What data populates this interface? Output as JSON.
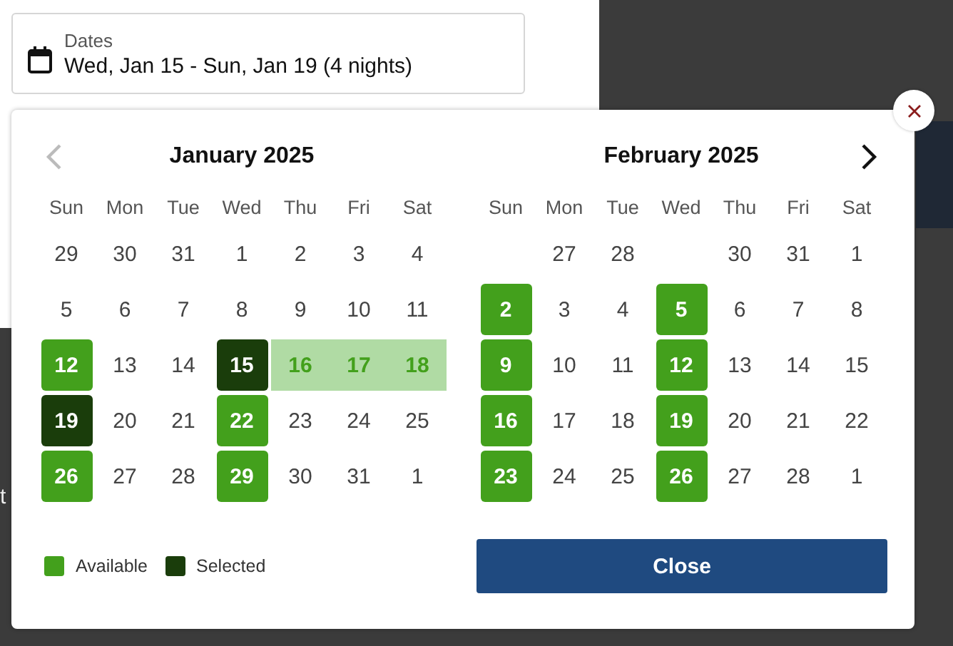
{
  "date_field": {
    "label": "Dates",
    "value": "Wed, Jan 15 - Sun, Jan 19 (4 nights)"
  },
  "background_text": "t",
  "calendar": {
    "prev_disabled": true,
    "next_disabled": false,
    "months": [
      {
        "title": "January 2025",
        "weekdays": [
          "Sun",
          "Mon",
          "Tue",
          "Wed",
          "Thu",
          "Fri",
          "Sat"
        ],
        "days": [
          {
            "day": "29",
            "kind": "plain"
          },
          {
            "day": "30",
            "kind": "plain"
          },
          {
            "day": "31",
            "kind": "plain"
          },
          {
            "day": "1",
            "kind": "plain"
          },
          {
            "day": "2",
            "kind": "plain"
          },
          {
            "day": "3",
            "kind": "plain"
          },
          {
            "day": "4",
            "kind": "plain"
          },
          {
            "day": "5",
            "kind": "plain"
          },
          {
            "day": "6",
            "kind": "plain"
          },
          {
            "day": "7",
            "kind": "plain"
          },
          {
            "day": "8",
            "kind": "plain"
          },
          {
            "day": "9",
            "kind": "plain"
          },
          {
            "day": "10",
            "kind": "plain"
          },
          {
            "day": "11",
            "kind": "plain"
          },
          {
            "day": "12",
            "kind": "available"
          },
          {
            "day": "13",
            "kind": "plain"
          },
          {
            "day": "14",
            "kind": "plain"
          },
          {
            "day": "15",
            "kind": "selected"
          },
          {
            "day": "16",
            "kind": "in_range"
          },
          {
            "day": "17",
            "kind": "in_range"
          },
          {
            "day": "18",
            "kind": "in_range"
          },
          {
            "day": "19",
            "kind": "selected"
          },
          {
            "day": "20",
            "kind": "plain"
          },
          {
            "day": "21",
            "kind": "plain"
          },
          {
            "day": "22",
            "kind": "available"
          },
          {
            "day": "23",
            "kind": "plain"
          },
          {
            "day": "24",
            "kind": "plain"
          },
          {
            "day": "25",
            "kind": "plain"
          },
          {
            "day": "26",
            "kind": "available"
          },
          {
            "day": "27",
            "kind": "plain"
          },
          {
            "day": "28",
            "kind": "plain"
          },
          {
            "day": "29",
            "kind": "available"
          },
          {
            "day": "30",
            "kind": "plain"
          },
          {
            "day": "31",
            "kind": "plain"
          },
          {
            "day": "1",
            "kind": "plain"
          }
        ]
      },
      {
        "title": "February 2025",
        "weekdays": [
          "Sun",
          "Mon",
          "Tue",
          "Wed",
          "Thu",
          "Fri",
          "Sat"
        ],
        "days": [
          {
            "kind": "blank"
          },
          {
            "day": "27",
            "kind": "plain"
          },
          {
            "day": "28",
            "kind": "plain"
          },
          {
            "kind": "blank"
          },
          {
            "day": "30",
            "kind": "plain"
          },
          {
            "day": "31",
            "kind": "plain"
          },
          {
            "day": "1",
            "kind": "plain"
          },
          {
            "day": "2",
            "kind": "available"
          },
          {
            "day": "3",
            "kind": "plain"
          },
          {
            "day": "4",
            "kind": "plain"
          },
          {
            "day": "5",
            "kind": "available"
          },
          {
            "day": "6",
            "kind": "plain"
          },
          {
            "day": "7",
            "kind": "plain"
          },
          {
            "day": "8",
            "kind": "plain"
          },
          {
            "day": "9",
            "kind": "available"
          },
          {
            "day": "10",
            "kind": "plain"
          },
          {
            "day": "11",
            "kind": "plain"
          },
          {
            "day": "12",
            "kind": "available"
          },
          {
            "day": "13",
            "kind": "plain"
          },
          {
            "day": "14",
            "kind": "plain"
          },
          {
            "day": "15",
            "kind": "plain"
          },
          {
            "day": "16",
            "kind": "available"
          },
          {
            "day": "17",
            "kind": "plain"
          },
          {
            "day": "18",
            "kind": "plain"
          },
          {
            "day": "19",
            "kind": "available"
          },
          {
            "day": "20",
            "kind": "plain"
          },
          {
            "day": "21",
            "kind": "plain"
          },
          {
            "day": "22",
            "kind": "plain"
          },
          {
            "day": "23",
            "kind": "available"
          },
          {
            "day": "24",
            "kind": "plain"
          },
          {
            "day": "25",
            "kind": "plain"
          },
          {
            "day": "26",
            "kind": "available"
          },
          {
            "day": "27",
            "kind": "plain"
          },
          {
            "day": "28",
            "kind": "plain"
          },
          {
            "day": "1",
            "kind": "plain"
          }
        ]
      }
    ],
    "legend": [
      {
        "label": "Available",
        "color": "#43a01c"
      },
      {
        "label": "Selected",
        "color": "#1a3d0b"
      }
    ],
    "close_button": "Close"
  }
}
